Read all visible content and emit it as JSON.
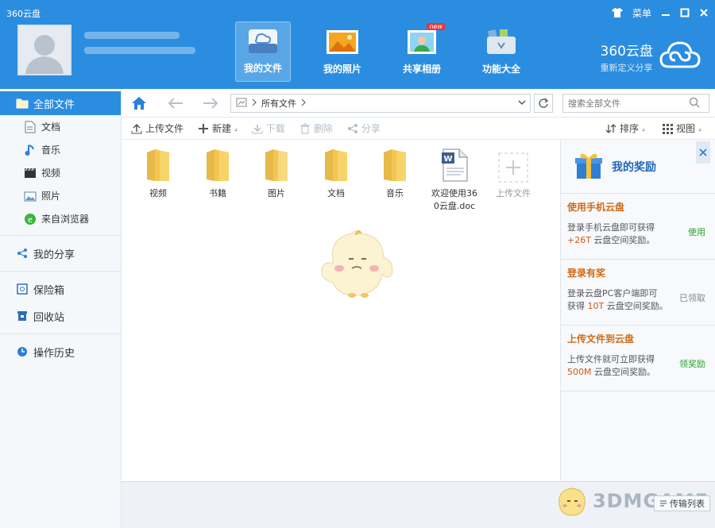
{
  "window": {
    "title": "360云盘",
    "menu_label": "菜单"
  },
  "nav_tabs": [
    {
      "label": "我的文件",
      "icon": "cloud-box-icon",
      "active": true
    },
    {
      "label": "我的照片",
      "icon": "photo-icon",
      "active": false
    },
    {
      "label": "共享相册",
      "icon": "shared-album-icon",
      "active": false,
      "badge": "new"
    },
    {
      "label": "功能大全",
      "icon": "toolbox-icon",
      "active": false
    }
  ],
  "brand": {
    "name": "360云盘",
    "slogan": "重新定义分享"
  },
  "sidebar": {
    "all_files": "全部文件",
    "categories": [
      {
        "label": "文档",
        "icon": "document-icon"
      },
      {
        "label": "音乐",
        "icon": "music-icon"
      },
      {
        "label": "视频",
        "icon": "video-icon"
      },
      {
        "label": "照片",
        "icon": "photo-icon"
      },
      {
        "label": "来自浏览器",
        "icon": "browser-icon"
      }
    ],
    "my_share": "我的分享",
    "safe_box": "保险箱",
    "recycle_bin": "回收站",
    "history": "操作历史"
  },
  "address": {
    "crumb": "所有文件",
    "search_placeholder": "搜索全部文件"
  },
  "toolbar": {
    "upload": "上传文件",
    "new": "新建",
    "download": "下载",
    "delete": "删除",
    "share": "分享",
    "sort": "排序",
    "view": "视图"
  },
  "files": [
    {
      "name": "视频",
      "type": "folder"
    },
    {
      "name": "书籍",
      "type": "folder"
    },
    {
      "name": "图片",
      "type": "folder"
    },
    {
      "name": "文档",
      "type": "folder"
    },
    {
      "name": "音乐",
      "type": "folder"
    },
    {
      "name": "欢迎使用360云盘.doc",
      "type": "doc"
    },
    {
      "name": "上传文件",
      "type": "upload"
    }
  ],
  "rewards": {
    "title": "我的奖励",
    "cards": [
      {
        "title": "使用手机云盘",
        "desc_line1": "登录手机云盘即可获得",
        "desc_highlight": "+26T",
        "desc_tail": " 云盘空间奖励。",
        "action": "使用",
        "action_type": "use"
      },
      {
        "title": "登录有奖",
        "desc_line1": "登录云盘PC客户端即可",
        "desc_prefix": "获得 ",
        "desc_highlight": "10T",
        "desc_tail": " 云盘空间奖励。",
        "action": "已领取",
        "action_type": "claimed"
      },
      {
        "title": "上传文件到云盘",
        "desc_line1": "上传文件就可立即获得",
        "desc_highlight": "500M",
        "desc_tail": " 云盘空间奖励。",
        "action": "领奖励",
        "action_type": "claim"
      }
    ]
  },
  "bottom": {
    "transfer_list": "传输列表",
    "watermark": "3DMGAME"
  },
  "colors": {
    "header_blue": "#2b8de0",
    "folder_yellow": "#f7d46a",
    "reward_orange": "#d26a15",
    "reward_green": "#2ba02b"
  }
}
